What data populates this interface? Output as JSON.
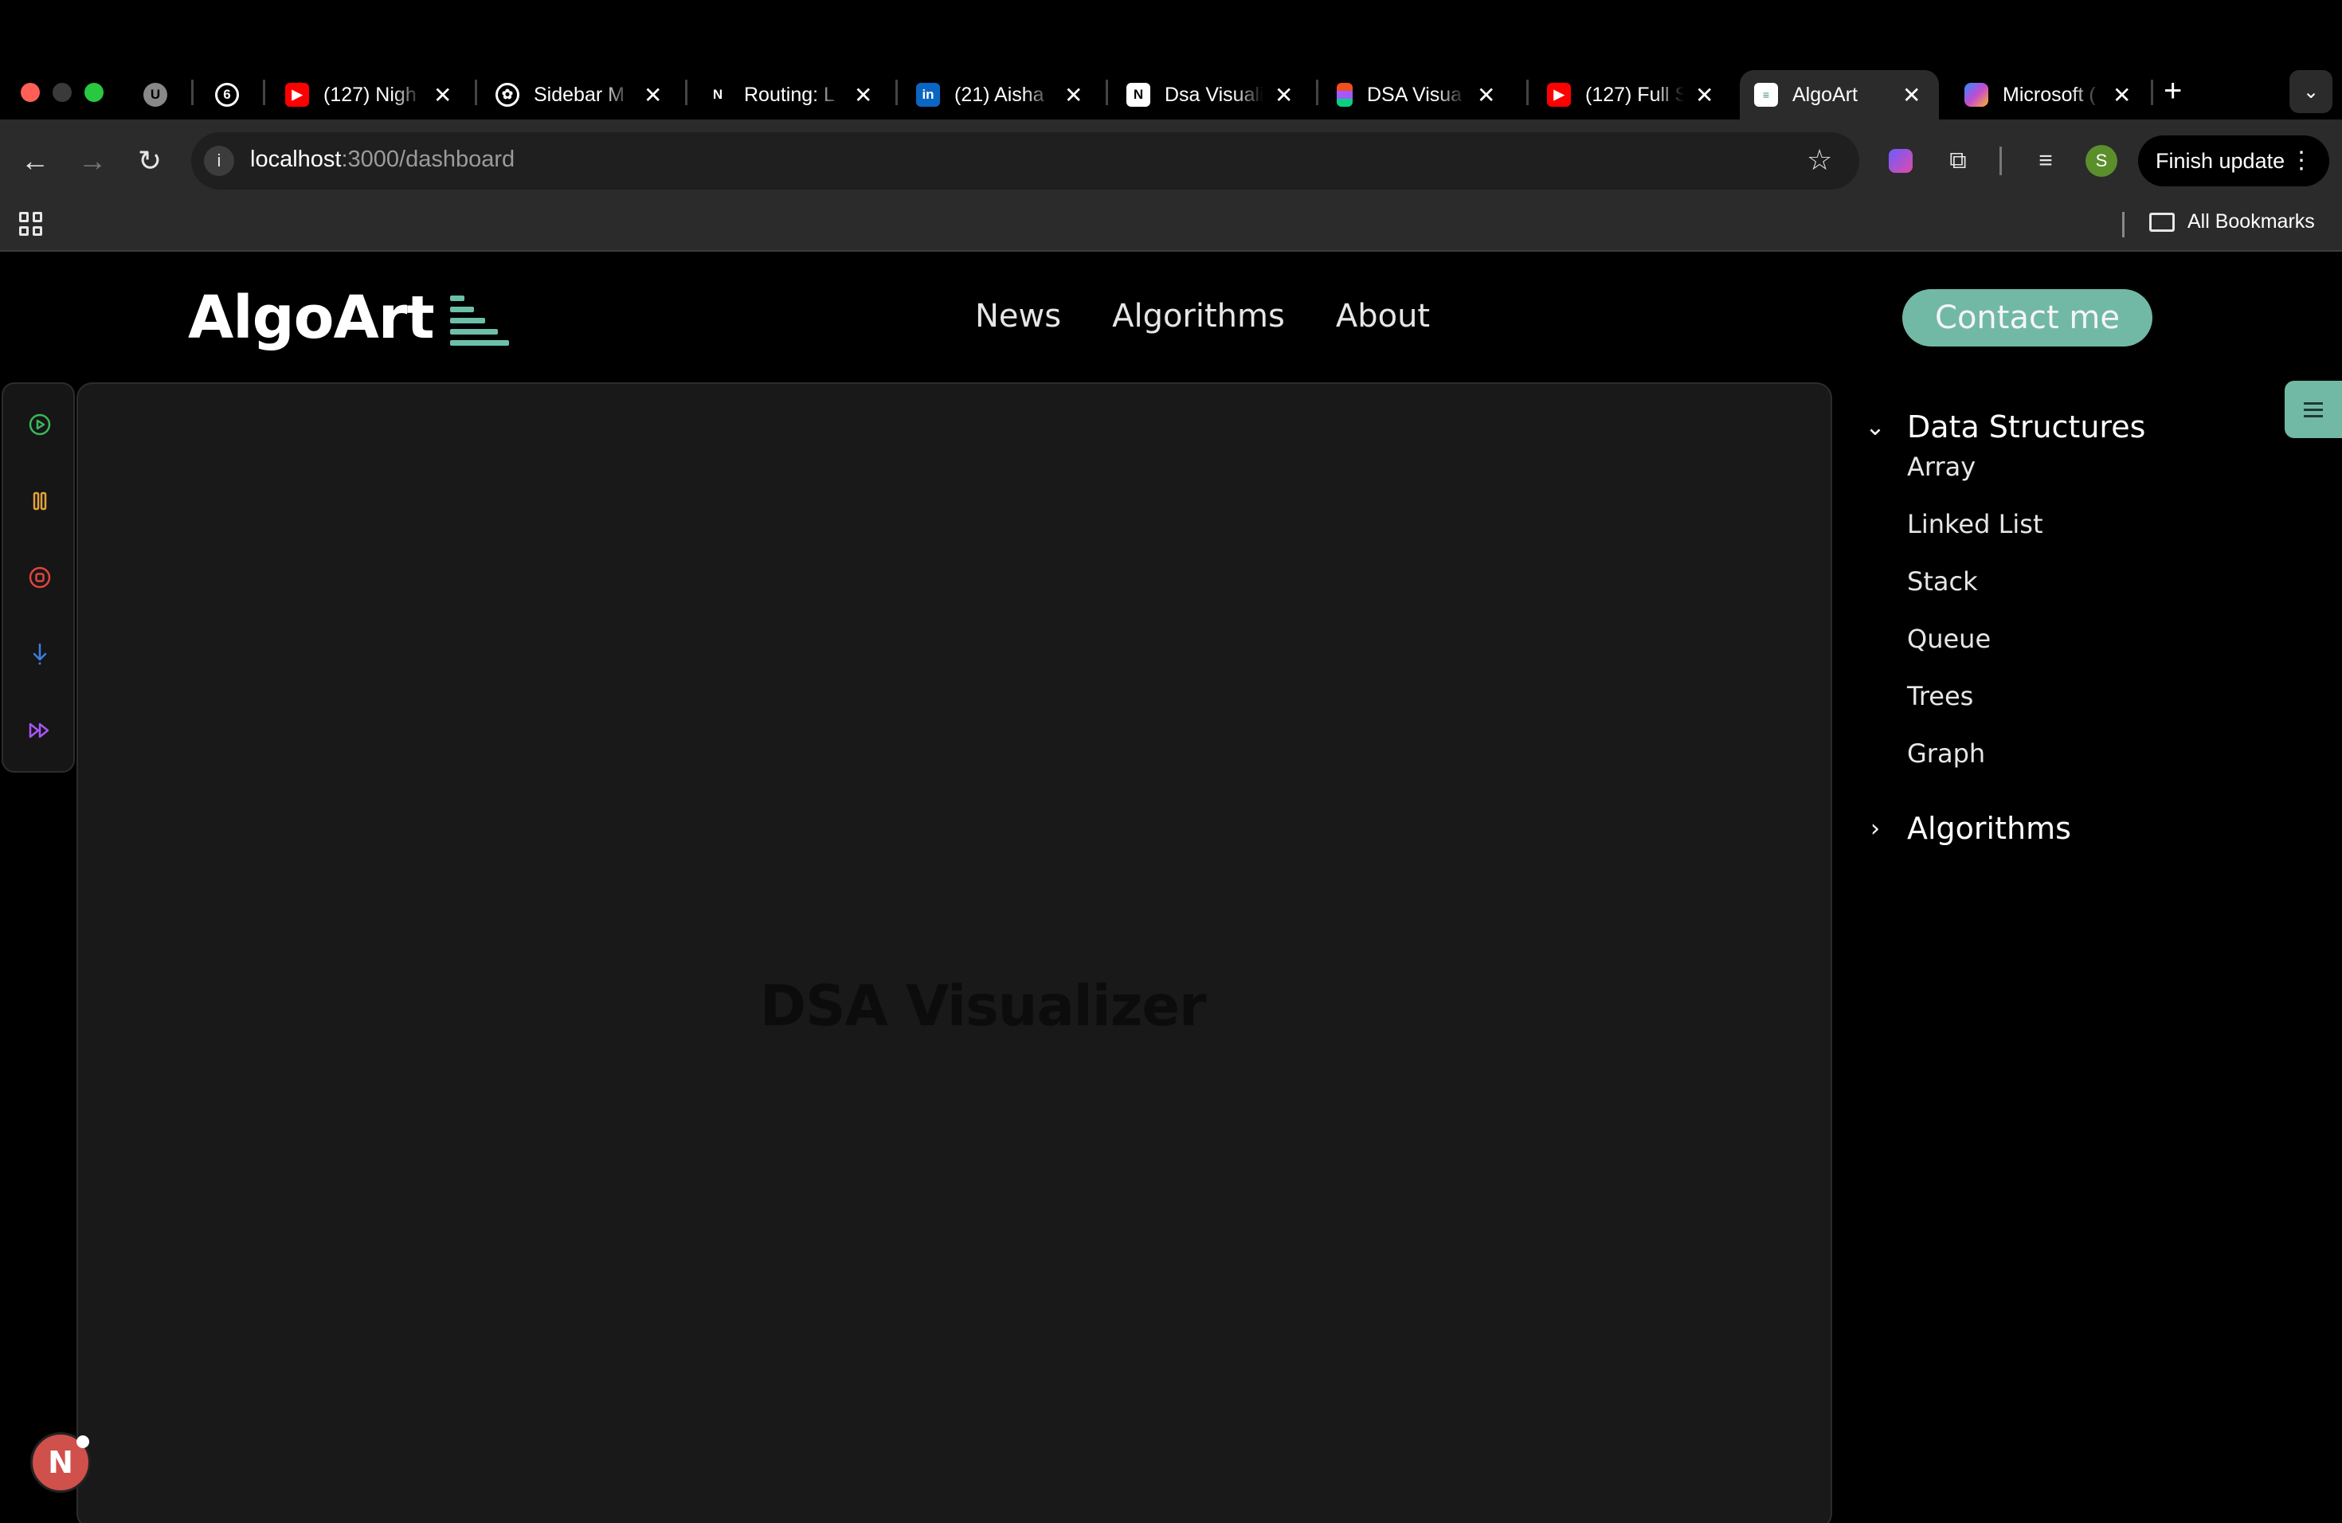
{
  "browser": {
    "tabs": [
      {
        "title": "",
        "icon": "extension-icon"
      },
      {
        "title": "",
        "icon": "chatgpt-icon"
      },
      {
        "title": "(127) Nigh",
        "icon": "youtube-icon"
      },
      {
        "title": "Sidebar M",
        "icon": "openai-icon"
      },
      {
        "title": "Routing: L",
        "icon": "nextjs-icon"
      },
      {
        "title": "(21) Aisha",
        "icon": "linkedin-icon"
      },
      {
        "title": "Dsa Visuali",
        "icon": "notion-icon"
      },
      {
        "title": "DSA Visua",
        "icon": "figma-icon"
      },
      {
        "title": "(127) Full S",
        "icon": "youtube-icon"
      },
      {
        "title": "AlgoArt",
        "icon": "document-icon"
      },
      {
        "title": "Microsoft (",
        "icon": "copilot-icon"
      }
    ],
    "url_host": "localhost",
    "url_path": ":3000/dashboard",
    "profile_initial": "S",
    "finish_update": "Finish update",
    "all_bookmarks": "All Bookmarks"
  },
  "site": {
    "logo": "AlgoArt",
    "nav": [
      "News",
      "Algorithms",
      "About"
    ],
    "contact": "Contact me",
    "canvas_title": "DSA Visualizer",
    "sidebar": {
      "data_structures": {
        "label": "Data Structures",
        "items": [
          "Array",
          "Linked List",
          "Stack",
          "Queue",
          "Trees",
          "Graph"
        ]
      },
      "algorithms": {
        "label": "Algorithms"
      }
    },
    "dev_badge": "N"
  },
  "colors": {
    "accent": "#72b9a5",
    "play": "#3bb85a",
    "pause": "#e2a33b",
    "stop": "#e0443e",
    "step": "#3b7de0",
    "fast_forward": "#a855f7"
  }
}
